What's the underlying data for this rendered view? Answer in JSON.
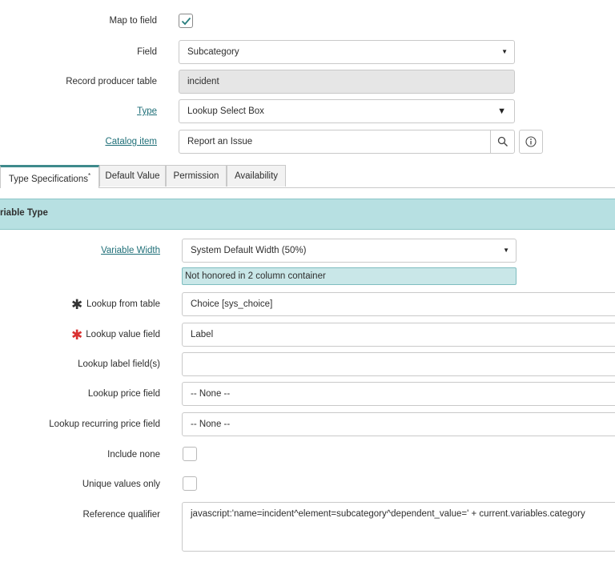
{
  "colors": {
    "link": "#1f6f78",
    "section_bg": "#b7e0e2",
    "hint_bg": "#c9e7e8",
    "required_red": "#d93030",
    "required_dark": "#333333",
    "tab_active_border": "#3e8a8c"
  },
  "top": {
    "map_to_field_label": "Map to field",
    "map_to_field_checked": true,
    "field_label": "Field",
    "field_value": "Subcategory",
    "record_producer_table_label": "Record producer table",
    "record_producer_table_value": "incident",
    "type_label": "Type",
    "type_value": "Lookup Select Box",
    "catalog_item_label": "Catalog item",
    "catalog_item_value": "Report an Issue",
    "icons": {
      "search": "search-icon",
      "info": "info-icon",
      "caret": "caret-down-icon",
      "check": "check-icon"
    }
  },
  "tabs": [
    {
      "label": "Type Specifications",
      "required_marker": "*",
      "active": true
    },
    {
      "label": "Default Value",
      "active": false
    },
    {
      "label": "Permission",
      "active": false
    },
    {
      "label": "Availability",
      "active": false
    }
  ],
  "section": {
    "title": "riable Type"
  },
  "form": {
    "variable_width_label": "Variable Width",
    "variable_width_value": "System Default Width (50%)",
    "variable_width_hint": "Not honored in 2 column container",
    "lookup_from_table_label": "Lookup from table",
    "lookup_from_table_value": "Choice [sys_choice]",
    "lookup_value_field_label": "Lookup value field",
    "lookup_value_field_value": "Label",
    "lookup_label_fields_label": "Lookup label field(s)",
    "lookup_label_fields_value": "",
    "lookup_price_field_label": "Lookup price field",
    "lookup_price_field_value": "-- None --",
    "lookup_recurring_price_field_label": "Lookup recurring price field",
    "lookup_recurring_price_field_value": "-- None --",
    "include_none_label": "Include none",
    "include_none_checked": false,
    "unique_values_only_label": "Unique values only",
    "unique_values_only_checked": false,
    "reference_qualifier_label": "Reference qualifier",
    "reference_qualifier_value": "javascript:'name=incident^element=subcategory^dependent_value=' + current.variables.category",
    "required_marker": "✱"
  }
}
